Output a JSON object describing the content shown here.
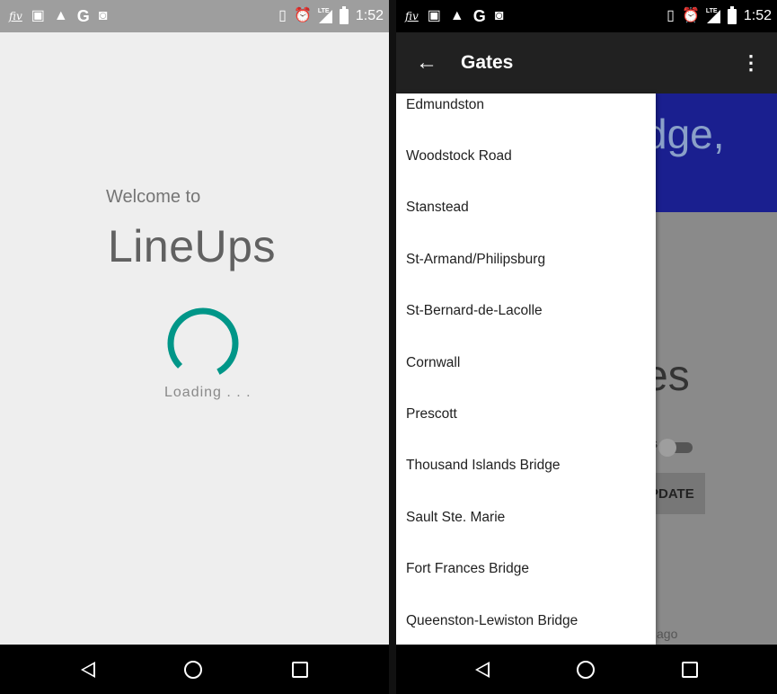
{
  "status_bar": {
    "time": "1:52",
    "lte": "LTE",
    "icons": [
      "fiverr-icon",
      "image-icon",
      "drive-icon",
      "google-icon",
      "camera-icon",
      "vibrate-icon",
      "alarm-icon",
      "signal-icon",
      "battery-icon"
    ]
  },
  "splash": {
    "welcome": "Welcome to",
    "app_name": "LineUps",
    "loading": "Loading . . .",
    "spinner_color": "#009688"
  },
  "appbar": {
    "title": "Gates"
  },
  "background": {
    "partial_title": "dge,",
    "partial_heading": "es",
    "partial_toggle_label": "s",
    "partial_button": "PDATE",
    "partial_footer": "ago",
    "accent_color": "#1a1f8f"
  },
  "drawer": {
    "gates": [
      "Edmundston",
      "Woodstock Road",
      "Stanstead",
      "St-Armand/Philipsburg",
      "St-Bernard-de-Lacolle",
      "Cornwall",
      "Prescott",
      "Thousand Islands Bridge",
      "Sault Ste. Marie",
      "Fort Frances Bridge",
      "Queenston-Lewiston Bridge"
    ]
  }
}
